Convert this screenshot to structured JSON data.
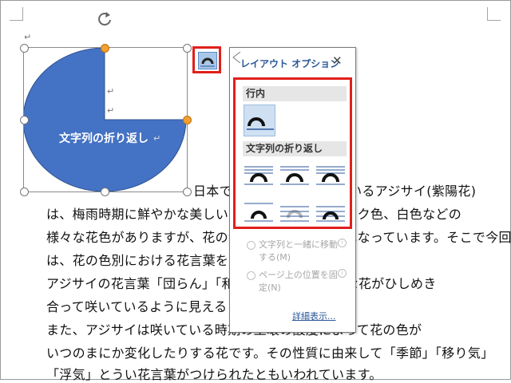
{
  "document": {
    "shape_text": "文字列の折り返し",
    "lines": [
      "日本で古くから親しまれているアジサイ(紫陽花)",
      "は、梅雨時期に鮮やかな美しい花を咲かせます。ピンク色、白色などの",
      "様々な花色がありますが、花の色によって花言葉が異なっています。そこで今回",
      "は、花の色別における花言葉をまとめてみました。",
      "アジサイの花言葉「団らん」「和気あいあい」。小さな花がひしめき",
      "合って咲いているように見えることから来ています。",
      "また、アジサイは咲いている時期の土壌の酸度によって花の色が",
      "いつのまにか変化したりする花です。その性質に由来して「季節」「移り気」",
      "「浮気」とうい花言葉がつけられたともいわれています。"
    ],
    "paragraph_mark": "↵"
  },
  "layout_panel": {
    "title": "レイアウト オプション",
    "close_label": "✕",
    "section_inline": "行内",
    "section_wrap": "文字列の折り返し",
    "options": [
      {
        "label": "文字列と一緒に移動する(M)"
      },
      {
        "label": "ページ上の位置を固定(N)"
      }
    ],
    "details_link": "詳細表示..."
  },
  "colors": {
    "shape_fill": "#4472c4",
    "accent": "#2b579a",
    "highlight_border": "#e0201b",
    "handle_yellow": "#f0a030"
  },
  "icons": {
    "rotate": "rotate-handle-icon",
    "layout_options": "layout-options-icon"
  }
}
